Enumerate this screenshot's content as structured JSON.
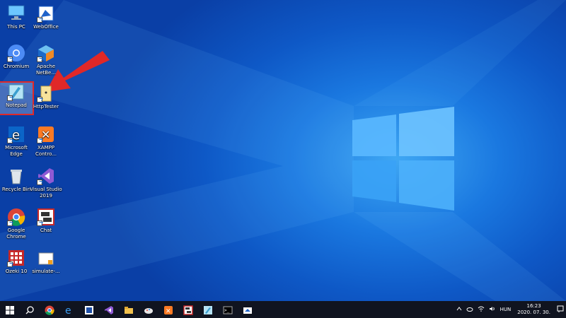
{
  "desktop": {
    "icons": [
      {
        "label": "This PC"
      },
      {
        "label": "WebOffice"
      },
      {
        "label": "Chromium"
      },
      {
        "label": "Apache NetBe..."
      },
      {
        "label": "Notepad"
      },
      {
        "label": "HttpTester"
      },
      {
        "label": "Microsoft Edge"
      },
      {
        "label": "XAMPP Contro..."
      },
      {
        "label": "Recycle Bin"
      },
      {
        "label": "Visual Studio 2019"
      },
      {
        "label": "Google Chrome"
      },
      {
        "label": "Chat"
      },
      {
        "label": "Ozeki 10"
      },
      {
        "label": "simulate-..."
      }
    ]
  },
  "taskbar": {
    "pinned": [
      "windows-start-icon",
      "search-icon",
      "chrome-icon",
      "edge-icon",
      "app-icon",
      "visual-studio-icon",
      "file-explorer-icon",
      "paint-icon",
      "xampp-icon",
      "chat-icon",
      "notepad-icon",
      "terminal-icon",
      "app-icon"
    ]
  },
  "tray": {
    "language": "HUN",
    "time": "16:23",
    "date": "2020. 07. 30."
  },
  "colors": {
    "accent": "#0e58c6",
    "highlight": "#e02828"
  }
}
